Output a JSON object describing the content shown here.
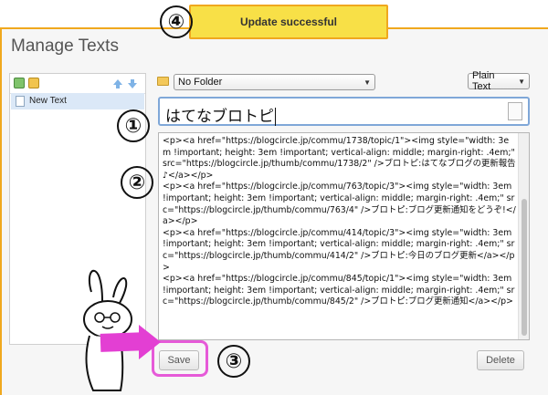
{
  "toast": {
    "message": "Update successful"
  },
  "page": {
    "title": "Manage Texts"
  },
  "callouts": {
    "c1": "①",
    "c2": "②",
    "c3": "③",
    "c4": "④"
  },
  "list": {
    "items": [
      {
        "label": "New Text"
      }
    ]
  },
  "folder_select": {
    "selected": "No Folder"
  },
  "format_select": {
    "selected": "Plain Text"
  },
  "title_field": {
    "value": "はてなブロトピ"
  },
  "body_field": {
    "value": "<p><a href=\"https://blogcircle.jp/commu/1738/topic/1\"><img style=\"width: 3em !important; height: 3em !important; vertical-align: middle; margin-right: .4em;\" src=\"https://blogcircle.jp/thumb/commu/1738/2\" />ブロトピ:はてなブログの更新報告♪</a></p>\n<p><a href=\"https://blogcircle.jp/commu/763/topic/3\"><img style=\"width: 3em !important; height: 3em !important; vertical-align: middle; margin-right: .4em;\" src=\"https://blogcircle.jp/thumb/commu/763/4\" />ブロトピ:ブログ更新通知をどうぞ!</a></p>\n<p><a href=\"https://blogcircle.jp/commu/414/topic/3\"><img style=\"width: 3em !important; height: 3em !important; vertical-align: middle; margin-right: .4em;\" src=\"https://blogcircle.jp/thumb/commu/414/2\" />ブロトピ:今日のブログ更新</a></p>\n<p><a href=\"https://blogcircle.jp/commu/845/topic/1\"><img style=\"width: 3em !important; height: 3em !important; vertical-align: middle; margin-right: .4em;\" src=\"https://blogcircle.jp/thumb/commu/845/2\" />ブロトピ:ブログ更新通知</a></p>"
  },
  "buttons": {
    "save": "Save",
    "delete": "Delete"
  },
  "colors": {
    "accent": "#f0a81e",
    "toast_bg": "#f8e047",
    "highlight": "#e65ad8"
  },
  "icons": [
    "add-text-icon",
    "import-icon",
    "move-up-icon",
    "move-down-icon",
    "document-icon",
    "folder-icon",
    "page-icon"
  ]
}
